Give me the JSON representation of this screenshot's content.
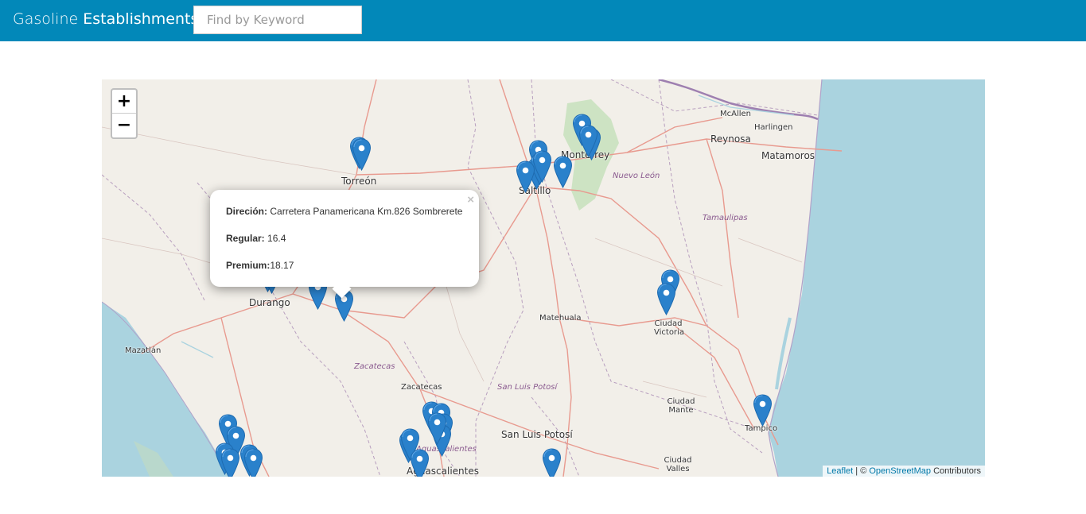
{
  "header": {
    "brand_light": "Gasoline",
    "brand_bold": "Establishments",
    "search_placeholder": "Find by Keyword"
  },
  "map": {
    "zoom_in": "+",
    "zoom_out": "−",
    "cities": [
      {
        "name": "McAllen"
      },
      {
        "name": "Harlingen"
      },
      {
        "name": "Reynosa"
      },
      {
        "name": "Matamoros"
      },
      {
        "name": "Monterrey"
      },
      {
        "name": "Torreón"
      },
      {
        "name": "Saltillo"
      },
      {
        "name": "Durango"
      },
      {
        "name": "Matehuala"
      },
      {
        "name": "Ciudad Victoria"
      },
      {
        "name": "Mazatlán"
      },
      {
        "name": "Zacatecas"
      },
      {
        "name": "Ciudad Mante"
      },
      {
        "name": "San Luis Potosí"
      },
      {
        "name": "Tampico"
      },
      {
        "name": "Ciudad Valles"
      },
      {
        "name": "Aguascalientes"
      }
    ],
    "states": [
      "Nuevo León",
      "Tamaulipas",
      "Zacatecas",
      "San Luis Potosí",
      "Aguascalientes"
    ],
    "marker_icon": "map-marker-icon",
    "marker_color": "#2a81cb",
    "popup": {
      "direction_label": "Direción:",
      "direction_value": "Carretera Panamericana Km.826 Sombrerete",
      "regular_label": "Regular:",
      "regular_value": "16.4",
      "premium_label": "Premium:",
      "premium_value": "18.17",
      "close": "×"
    },
    "attribution": {
      "leaflet": "Leaflet",
      "sep": " | © ",
      "osm": "OpenStreetMap",
      "contrib": " Contributors"
    }
  }
}
